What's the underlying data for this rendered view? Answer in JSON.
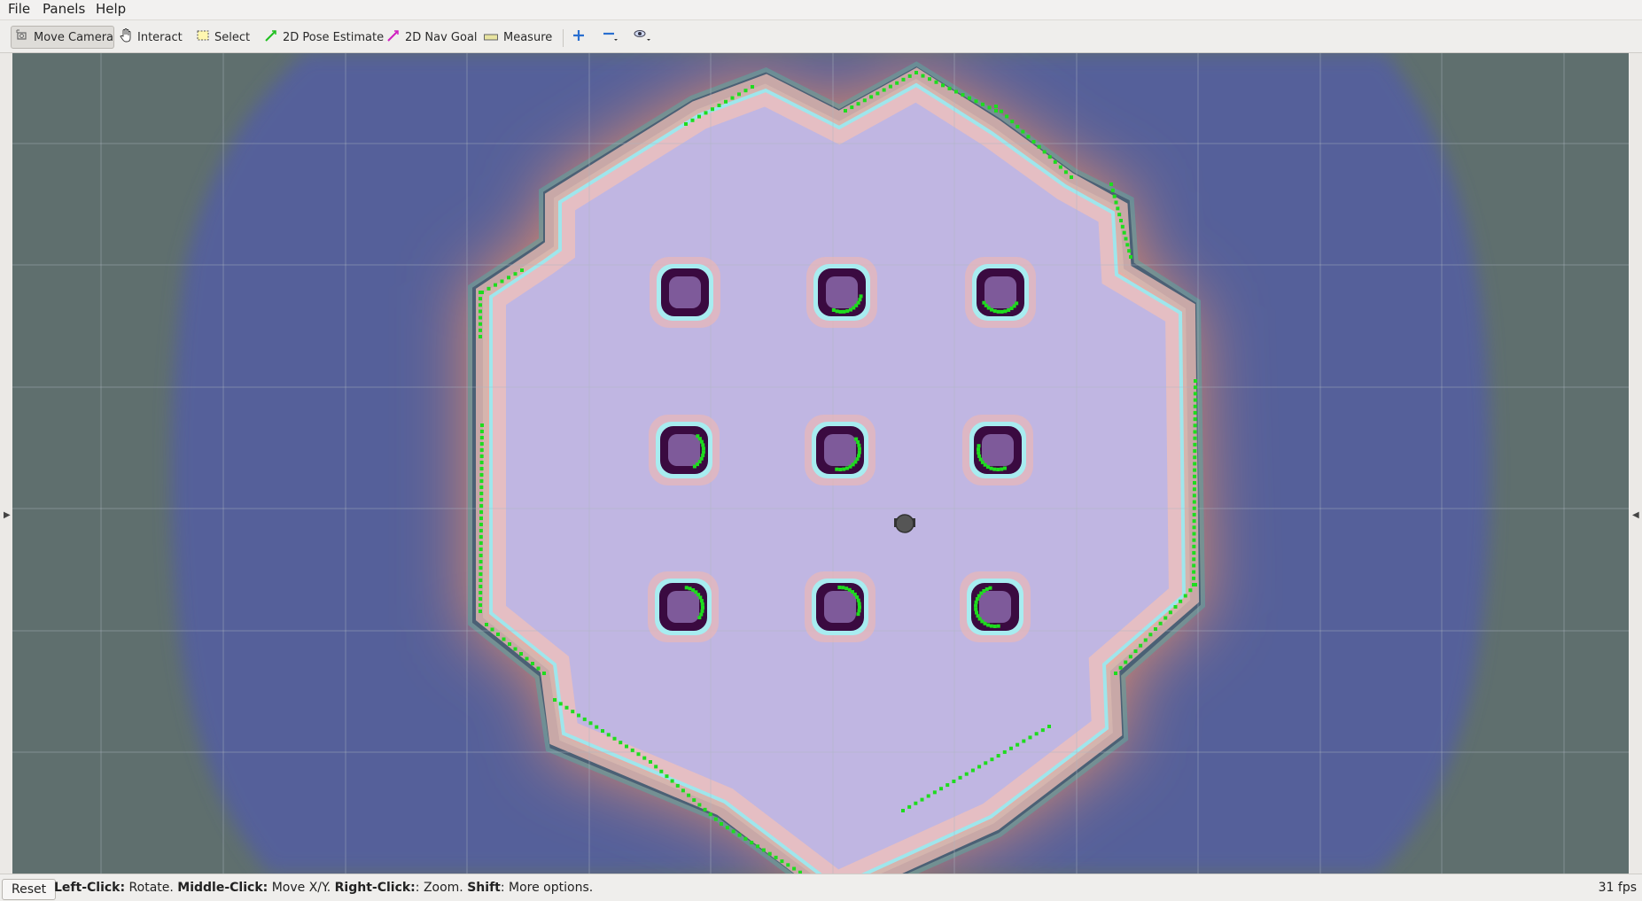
{
  "menu": {
    "file": "File",
    "panels": "Panels",
    "help": "Help"
  },
  "toolbar": {
    "move_camera": "Move Camera",
    "interact": "Interact",
    "select": "Select",
    "pose_estimate": "2D Pose Estimate",
    "nav_goal": "2D Nav Goal",
    "measure": "Measure"
  },
  "status": {
    "reset": "Reset",
    "left_click_key": "Left-Click:",
    "left_click_action": " Rotate. ",
    "middle_click_key": "Middle-Click:",
    "middle_click_action": " Move X/Y. ",
    "right_click_key": "Right-Click:",
    "right_click_action": ": Zoom. ",
    "shift_key": "Shift",
    "shift_action": ": More options.",
    "fps": "31 fps"
  },
  "colors": {
    "background_unknown": "#5f6f6e",
    "costmap_far": "#55609a",
    "costmap_inflation": "#e08a6a",
    "free_space": "#c0b6e2",
    "obstacle": "#3a0a40",
    "laser_scan": "#1edc1e"
  },
  "icons": {
    "move_camera": "move-camera-icon",
    "interact": "hand-icon",
    "select": "select-box-icon",
    "pose_estimate": "green-arrow-icon",
    "nav_goal": "magenta-arrow-icon",
    "measure": "ruler-icon",
    "zoom_in": "plus-icon",
    "zoom_out": "minus-icon",
    "view": "eye-icon"
  }
}
